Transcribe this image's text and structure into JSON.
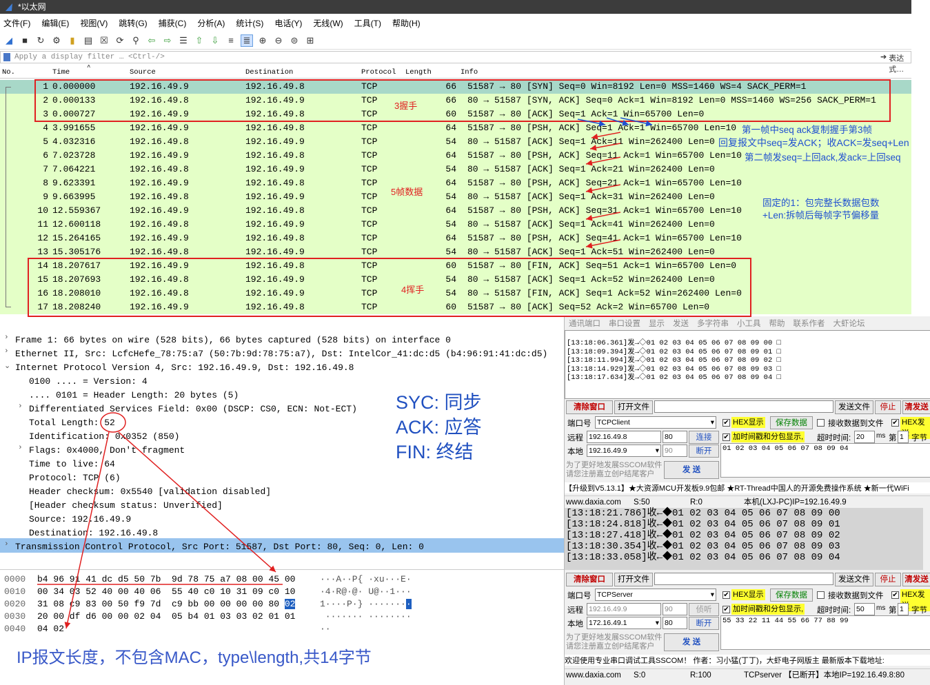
{
  "window": {
    "title": "*以太网"
  },
  "menu": [
    "文件(F)",
    "编辑(E)",
    "视图(V)",
    "跳转(G)",
    "捕获(C)",
    "分析(A)",
    "统计(S)",
    "电话(Y)",
    "无线(W)",
    "工具(T)",
    "帮助(H)"
  ],
  "filter": {
    "placeholder": "Apply a display filter … <Ctrl-/>",
    "expr_label": "表达式…"
  },
  "columns": {
    "no": "No.",
    "time": "Time",
    "source": "Source",
    "destination": "Destination",
    "protocol": "Protocol",
    "length": "Length",
    "info": "Info"
  },
  "packets": [
    {
      "no": "1",
      "time": "0.000000",
      "src": "192.16.49.9",
      "dst": "192.16.49.8",
      "proto": "TCP",
      "len": "66",
      "info": "51587 → 80 [SYN] Seq=0 Win=8192 Len=0 MSS=1460 WS=4 SACK_PERM=1"
    },
    {
      "no": "2",
      "time": "0.000133",
      "src": "192.16.49.8",
      "dst": "192.16.49.9",
      "proto": "TCP",
      "len": "66",
      "info": "80 → 51587 [SYN, ACK] Seq=0 Ack=1 Win=8192 Len=0 MSS=1460 WS=256 SACK_PERM=1"
    },
    {
      "no": "3",
      "time": "0.000727",
      "src": "192.16.49.9",
      "dst": "192.16.49.8",
      "proto": "TCP",
      "len": "60",
      "info": "51587 → 80 [ACK] Seq=1 Ack=1 Win=65700 Len=0"
    },
    {
      "no": "4",
      "time": "3.991655",
      "src": "192.16.49.9",
      "dst": "192.16.49.8",
      "proto": "TCP",
      "len": "64",
      "info": "51587 → 80 [PSH, ACK] Seq=1 Ack=1 Win=65700 Len=10"
    },
    {
      "no": "5",
      "time": "4.032316",
      "src": "192.16.49.8",
      "dst": "192.16.49.9",
      "proto": "TCP",
      "len": "54",
      "info": "80 → 51587 [ACK] Seq=1 Ack=11 Win=262400 Len=0"
    },
    {
      "no": "6",
      "time": "7.023728",
      "src": "192.16.49.9",
      "dst": "192.16.49.8",
      "proto": "TCP",
      "len": "64",
      "info": "51587 → 80 [PSH, ACK] Seq=11 Ack=1 Win=65700 Len=10"
    },
    {
      "no": "7",
      "time": "7.064221",
      "src": "192.16.49.8",
      "dst": "192.16.49.9",
      "proto": "TCP",
      "len": "54",
      "info": "80 → 51587 [ACK] Seq=1 Ack=21 Win=262400 Len=0"
    },
    {
      "no": "8",
      "time": "9.623391",
      "src": "192.16.49.9",
      "dst": "192.16.49.8",
      "proto": "TCP",
      "len": "64",
      "info": "51587 → 80 [PSH, ACK] Seq=21 Ack=1 Win=65700 Len=10"
    },
    {
      "no": "9",
      "time": "9.663995",
      "src": "192.16.49.8",
      "dst": "192.16.49.9",
      "proto": "TCP",
      "len": "54",
      "info": "80 → 51587 [ACK] Seq=1 Ack=31 Win=262400 Len=0"
    },
    {
      "no": "10",
      "time": "12.559367",
      "src": "192.16.49.9",
      "dst": "192.16.49.8",
      "proto": "TCP",
      "len": "64",
      "info": "51587 → 80 [PSH, ACK] Seq=31 Ack=1 Win=65700 Len=10"
    },
    {
      "no": "11",
      "time": "12.600118",
      "src": "192.16.49.8",
      "dst": "192.16.49.9",
      "proto": "TCP",
      "len": "54",
      "info": "80 → 51587 [ACK] Seq=1 Ack=41 Win=262400 Len=0"
    },
    {
      "no": "12",
      "time": "15.264165",
      "src": "192.16.49.9",
      "dst": "192.16.49.8",
      "proto": "TCP",
      "len": "64",
      "info": "51587 → 80 [PSH, ACK] Seq=41 Ack=1 Win=65700 Len=10"
    },
    {
      "no": "13",
      "time": "15.305176",
      "src": "192.16.49.8",
      "dst": "192.16.49.9",
      "proto": "TCP",
      "len": "54",
      "info": "80 → 51587 [ACK] Seq=1 Ack=51 Win=262400 Len=0"
    },
    {
      "no": "14",
      "time": "18.207617",
      "src": "192.16.49.9",
      "dst": "192.16.49.8",
      "proto": "TCP",
      "len": "60",
      "info": "51587 → 80 [FIN, ACK] Seq=51 Ack=1 Win=65700 Len=0"
    },
    {
      "no": "15",
      "time": "18.207693",
      "src": "192.16.49.8",
      "dst": "192.16.49.9",
      "proto": "TCP",
      "len": "54",
      "info": "80 → 51587 [ACK] Seq=1 Ack=52 Win=262400 Len=0"
    },
    {
      "no": "16",
      "time": "18.208010",
      "src": "192.16.49.8",
      "dst": "192.16.49.9",
      "proto": "TCP",
      "len": "54",
      "info": "80 → 51587 [FIN, ACK] Seq=1 Ack=52 Win=262400 Len=0"
    },
    {
      "no": "17",
      "time": "18.208240",
      "src": "192.16.49.9",
      "dst": "192.16.49.8",
      "proto": "TCP",
      "len": "60",
      "info": "51587 → 80 [ACK] Seq=52 Ack=2 Win=65700 Len=0"
    }
  ],
  "annotations": {
    "handshake": "3握手",
    "data5": "5帧数据",
    "wave4": "4挥手",
    "note1": "第一帧中seq ack复制握手第3帧",
    "note2": "回复报文中seq=发ACK；收ACK=发seq+Len",
    "note3": "第二帧发seq=上回ack,发ack=上回seq",
    "note4a": "固定的1：包完整长数据包数",
    "note4b": "+Len:拆帧后每帧字节偏移量",
    "syc": "SYC:  同步",
    "ack": "ACK:  应答",
    "fin": "FIN:  终结",
    "ip_note": "IP报文长度，不包含MAC，type\\length,共14字节"
  },
  "tree": [
    {
      "indent": 0,
      "twist": "›",
      "text": "Frame 1: 66 bytes on wire (528 bits), 66 bytes captured (528 bits) on interface 0"
    },
    {
      "indent": 0,
      "twist": "›",
      "text": "Ethernet II, Src: LcfcHefe_78:75:a7 (50:7b:9d:78:75:a7), Dst: IntelCor_41:dc:d5 (b4:96:91:41:dc:d5)"
    },
    {
      "indent": 0,
      "twist": "⌄",
      "text": "Internet Protocol Version 4, Src: 192.16.49.9, Dst: 192.16.49.8"
    },
    {
      "indent": 1,
      "twist": "",
      "text": "0100 .... = Version: 4"
    },
    {
      "indent": 1,
      "twist": "",
      "text": ".... 0101 = Header Length: 20 bytes (5)"
    },
    {
      "indent": 1,
      "twist": "›",
      "text": "Differentiated Services Field: 0x00 (DSCP: CS0, ECN: Not-ECT)"
    },
    {
      "indent": 1,
      "twist": "",
      "text": "Total Length: 52"
    },
    {
      "indent": 1,
      "twist": "",
      "text": "Identification: 0x0352 (850)"
    },
    {
      "indent": 1,
      "twist": "›",
      "text": "Flags: 0x4000, Don't fragment"
    },
    {
      "indent": 1,
      "twist": "",
      "text": "Time to live: 64"
    },
    {
      "indent": 1,
      "twist": "",
      "text": "Protocol: TCP (6)"
    },
    {
      "indent": 1,
      "twist": "",
      "text": "Header checksum: 0x5540 [validation disabled]"
    },
    {
      "indent": 1,
      "twist": "",
      "text": "[Header checksum status: Unverified]"
    },
    {
      "indent": 1,
      "twist": "",
      "text": "Source: 192.16.49.9"
    },
    {
      "indent": 1,
      "twist": "",
      "text": "Destination: 192.16.49.8"
    },
    {
      "indent": 0,
      "twist": "›",
      "text": "Transmission Control Protocol, Src Port: 51587, Dst Port: 80, Seq: 0, Len: 0"
    }
  ],
  "hex": [
    {
      "off": "0000",
      "bytes": "b4 96 91 41 dc d5 50 7b  9d 78 75 a7 08 00 45 00",
      "ascii": "···A··P{ ·xu···E·"
    },
    {
      "off": "0010",
      "bytes": "00 34 03 52 40 00 40 06  55 40 c0 10 31 09 c0 10",
      "ascii": "·4·R@·@· U@··1···"
    },
    {
      "off": "0020",
      "bytes": "31 08 c9 83 00 50 f9 7d  c9 bb 00 00 00 00 80",
      "last": "02",
      "ascii": "1····P·} ·······",
      "ascii_last": "·"
    },
    {
      "off": "0030",
      "bytes": "20 00 df d6 00 00 02 04  05 b4 01 03 03 02 01 01",
      "ascii": " ······· ········"
    },
    {
      "off": "0040",
      "bytes": "04 02",
      "ascii": "··"
    }
  ],
  "sscom": {
    "menu": [
      "通讯端口",
      "串口设置",
      "显示",
      "发送",
      "多字符串",
      "小工具",
      "帮助",
      "联系作者",
      "大虾论坛"
    ],
    "send_log": [
      "[13:18:06.361]发→◇01 02 03 04 05 06 07 08 09 00 □",
      "[13:18:09.394]发→◇01 02 03 04 05 06 07 08 09 01 □",
      "[13:18:11.994]发→◇01 02 03 04 05 06 07 08 09 02 □",
      "[13:18:14.929]发→◇01 02 03 04 05 06 07 08 09 03 □",
      "[13:18:17.634]发→◇01 02 03 04 05 06 07 08 09 04 □"
    ],
    "recv_log": [
      "[13:18:21.786]收←◆01 02 03 04 05 06 07 08 09 00",
      "[13:18:24.818]收←◆01 02 03 04 05 06 07 08 09 01",
      "[13:18:27.418]收←◆01 02 03 04 05 06 07 08 09 02",
      "[13:18:30.354]收←◆01 02 03 04 05 06 07 08 09 03",
      "[13:18:33.058]收←◆01 02 03 04 05 06 07 08 09 04"
    ],
    "clear_btn": "清除窗口",
    "open_file": "打开文件",
    "send_file": "发送文件",
    "stop": "停止",
    "clear_send": "清发送",
    "port_label": "端口号",
    "remote_label": "远程",
    "local_label": "本地",
    "hex_show": "HEX显示",
    "save_data": "保存数据",
    "recv_to_file": "接收数据到文件",
    "hex_send": "HEX发送",
    "timestamp": "加时间戳和分包显示,",
    "timeout_label": "超时时间:",
    "ms": "ms",
    "nth": "第",
    "byte": "字节",
    "register": "为了更好地发展SSCOM软件\n请您注册嘉立创P结尾客户",
    "send_btn": "发  送",
    "client": {
      "mode": "TCPClient",
      "remote_ip": "192.16.49.8",
      "remote_port": "80",
      "connect": "连接",
      "local_ip": "192.16.49.9",
      "local_port": "90",
      "disconnect": "断开",
      "timeout": "20",
      "nth_val": "1",
      "send_text": "01 02 03 04 05 06 07 08 09 04"
    },
    "server": {
      "mode": "TCPServer",
      "remote_ip": "192.16.49.9",
      "remote_port": "90",
      "listen": "侦听",
      "local_ip": "172.16.49.1",
      "local_port": "80",
      "disconnect": "断开",
      "timeout": "50",
      "nth_val": "1",
      "send_text": "55 33 22 11 44 55 66 77 88 99"
    },
    "ticker": "【升级到V5.13.1】★大资源MCU开发板9.9包邮 ★RT-Thread中国人的开源免费操作系统 ★新一代WiFi",
    "status1": {
      "site": "www.daxia.com",
      "s": "S:50",
      "r": "R:0",
      "info": "本机(LXJ-PC)IP=192.16.49.9"
    },
    "ticker2": "欢迎使用专业串口调试工具SSCOM！  作者：习小猛(丁丁)，大虾电子网版主  最新版本下载地址:",
    "status2": {
      "site": "www.daxia.com",
      "s": "S:0",
      "r": "R:100",
      "info": "TCPserver 【已断开】本地IP=192.16.49.8:80"
    }
  }
}
